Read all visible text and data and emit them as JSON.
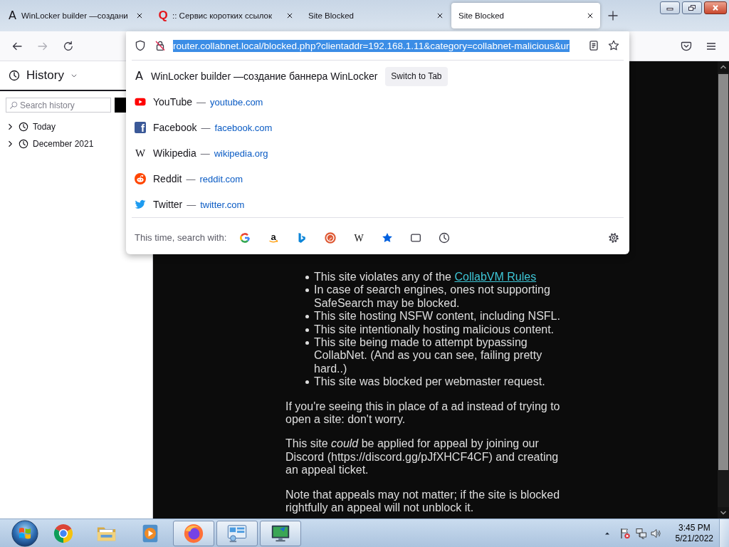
{
  "tabs": [
    {
      "favicon": {
        "kind": "letter",
        "text": "A"
      },
      "title": "WinLocker builder —создани",
      "selected": false
    },
    {
      "favicon": {
        "kind": "bold-letter",
        "text": "Q"
      },
      "title": ":: Сервис коротких ссылок",
      "selected": false
    },
    {
      "title": "Site Blocked",
      "selected": false
    },
    {
      "title": "Site Blocked",
      "selected": true
    }
  ],
  "navigation": [
    {
      "kind": "back",
      "disabled": false
    },
    {
      "kind": "forward",
      "disabled": true
    },
    {
      "kind": "reload",
      "disabled": false
    }
  ],
  "urlbar": {
    "value": "router.collabnet.local/blocked.php?clientaddr=192.168.1.11&category=collabnet-malicious&ur",
    "selected": true
  },
  "results": [
    {
      "kind": "tab",
      "favicon": {
        "kind": "letter",
        "text": "A"
      },
      "title": "WinLocker builder —создание баннера WinLocker",
      "action": "Switch to Tab"
    },
    {
      "kind": "site",
      "favicon": {
        "kind": "youtube"
      },
      "title": "YouTube",
      "separator": "—",
      "url": "youtube.com"
    },
    {
      "kind": "site",
      "favicon": {
        "kind": "facebook",
        "text": "f"
      },
      "title": "Facebook",
      "separator": "—",
      "url": "facebook.com"
    },
    {
      "kind": "site",
      "favicon": {
        "kind": "wikipedia",
        "text": "W"
      },
      "title": "Wikipedia",
      "separator": "—",
      "url": "wikipedia.org"
    },
    {
      "kind": "site",
      "favicon": {
        "kind": "reddit"
      },
      "title": "Reddit",
      "separator": "—",
      "url": "reddit.com"
    },
    {
      "kind": "site",
      "favicon": {
        "kind": "twitter"
      },
      "title": "Twitter",
      "separator": "—",
      "url": "twitter.com"
    }
  ],
  "search_with": {
    "label": "This time, search with:",
    "engines": [
      {
        "kind": "google"
      },
      {
        "kind": "amazon",
        "text": "a"
      },
      {
        "kind": "bing"
      },
      {
        "kind": "duckduckgo"
      },
      {
        "kind": "wikipedia",
        "text": "W"
      },
      {
        "kind": "bookmarks"
      },
      {
        "kind": "tabs"
      },
      {
        "kind": "history"
      }
    ]
  },
  "sidebar": {
    "title": "History",
    "search": {
      "placeholder": "Search history"
    },
    "groups": [
      {
        "label": "Today",
        "expanded": false
      },
      {
        "label": "December 2021",
        "expanded": false
      }
    ]
  },
  "page": {
    "list": [
      {
        "text": "This site violates any of the ",
        "link": "CollabVM Rules"
      },
      {
        "text": "In case of search engines, ones not supporting SafeSearch may be blocked."
      },
      {
        "text": "This site hosting NSFW content, including NSFL."
      },
      {
        "text": "This site intentionally hosting malicious content."
      },
      {
        "text": "This site being made to attempt bypassing CollabNet. (And as you can see, failing pretty hard..)"
      },
      {
        "text": "This site was blocked per webmaster request."
      }
    ],
    "paragraphs": [
      "If you're seeing this in place of a ad instead of trying to open a site: don't worry.",
      "This site *could* be applied for appeal by joining our Discord (https://discord.gg/pJfXHCF4CF) and creating an appeal ticket.",
      "Note that appeals may not matter; if the site is blocked rightfully an appeal will not unblock it."
    ]
  },
  "taskbar": {
    "apps": [
      {
        "kind": "chrome",
        "running": false
      },
      {
        "kind": "explorer",
        "running": false
      },
      {
        "kind": "media",
        "running": false
      },
      {
        "kind": "firefox",
        "running": true
      },
      {
        "kind": "dashboard",
        "running": true
      },
      {
        "kind": "monitor",
        "running": true
      }
    ],
    "clock": {
      "time": "3:45 PM",
      "date": "5/21/2022"
    }
  }
}
